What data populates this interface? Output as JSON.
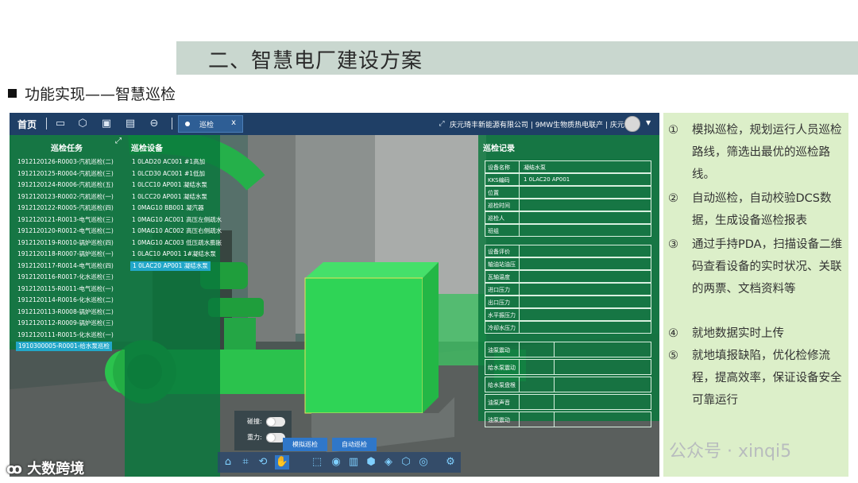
{
  "slide": {
    "title": "二、智慧电厂建设方案",
    "subtitle": "功能实现——智慧巡检"
  },
  "app": {
    "toolbar": {
      "home_label": "首页",
      "tab_label": "巡检",
      "tab_close": "x",
      "company": "庆元琦丰新能源有限公司 | 9MW生物质热电联产 | 庆元"
    },
    "tasks": {
      "header": "巡检任务",
      "items": [
        "1912120126-R0003-汽机巡检(二)",
        "1912120125-R0004-汽机巡检(三)",
        "1912120124-R0006-汽机巡检(五)",
        "1912120123-R0002-汽机巡检(一)",
        "1912120122-R0005-汽机巡检(四)",
        "1912120121-R0013-电气巡检(三)",
        "1912120120-R0012-电气巡检(二)",
        "1912120119-R0010-锅炉巡检(四)",
        "1912120118-R0007-锅炉巡检(一)",
        "1912120117-R0014-电气巡检(四)",
        "1912120116-R0017-化水巡检(三)",
        "1912120115-R0011-电气巡检(一)",
        "1912120114-R0016-化水巡检(二)",
        "1912120113-R0008-锅炉巡检(二)",
        "1912120112-R0009-锅炉巡检(三)",
        "1912120111-R0015-化水巡检(一)",
        "1910300005-R0001-给水泵巡检"
      ]
    },
    "devices": {
      "header": "巡检设备",
      "items": [
        "1 0LAD20 AC001 #1高加",
        "1 0LCD30 AC001 #1低加",
        "1 0LCC10 AP001 凝结水泵",
        "1 0LCC20 AP001 凝结水泵",
        "1 0MAG10 BB001 凝汽器",
        "1 0MAG10 AC001 高压左侧疏水",
        "1 0MAG10 AC002 高压右侧疏水",
        "1 0MAG10 AC003 低压疏水膨胀",
        "1 0LAC10 AP001 1#凝结水泵",
        "1 0LAC20 AP001 凝结水泵"
      ]
    },
    "records": {
      "header": "巡检记录",
      "info_rows": [
        {
          "k": "设备名称",
          "v": "凝结水泵"
        },
        {
          "k": "KKS编码",
          "v": "1 0LAC20 AP001"
        },
        {
          "k": "位置",
          "v": ""
        },
        {
          "k": "巡检时间",
          "v": ""
        },
        {
          "k": "巡检人",
          "v": ""
        },
        {
          "k": "班组",
          "v": ""
        }
      ],
      "param_rows": [
        "设备评价",
        "轴油站油压",
        "瓦轴温度",
        "进口压力",
        "出口压力",
        "水平振压力",
        "冷却水压力"
      ],
      "check_rows": [
        "油泵震动",
        "给水泵震动",
        "给水泵盘根",
        "油泵声音",
        "油泵震动"
      ]
    },
    "toggles": {
      "collision": "碰撞:",
      "gravity": "重力:"
    },
    "modes": {
      "simulate": "模拟巡检",
      "auto": "自动巡检"
    }
  },
  "info": [
    {
      "num": "①",
      "text": "模拟巡检，规划运行人员巡检路线，筛选出最优的巡检路线。"
    },
    {
      "num": "②",
      "text": "自动巡检，自动校验DCS数据，生成设备巡检报表"
    },
    {
      "num": "③",
      "text": "通过手持PDA，扫描设备二维码查看设备的实时状况、关联的两票、文档资料等"
    },
    {
      "num": "④",
      "text": "就地数据实时上传"
    },
    {
      "num": "⑤",
      "text": "就地填报缺陷，优化检修流程，提高效率，保证设备安全可靠运行"
    }
  ],
  "watermarks": {
    "left": "大数跨境",
    "right": "公众号 · xinqi5"
  }
}
